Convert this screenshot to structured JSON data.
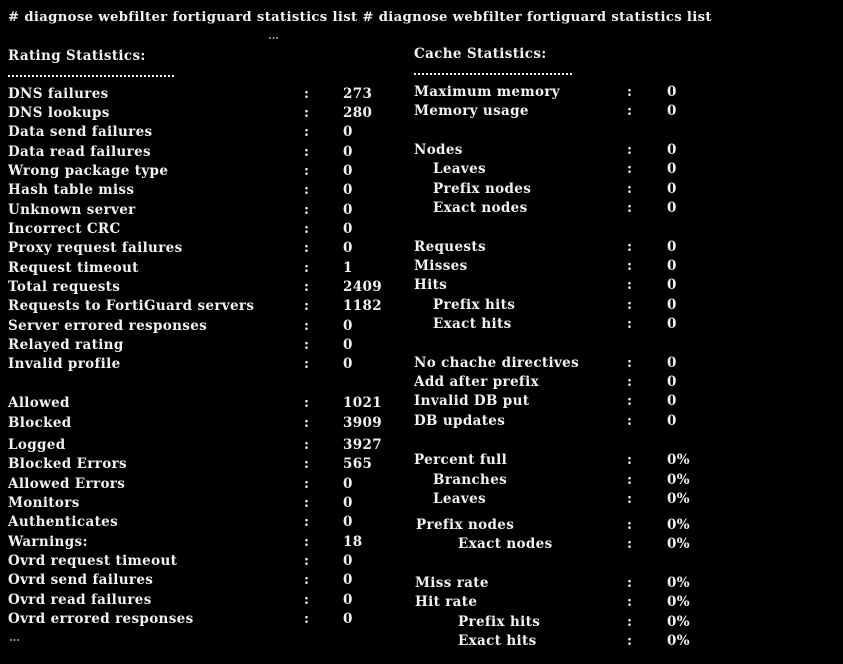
{
  "command": "# diagnose webfilter fortiguard statistics list # diagnose webfilter fortiguard statistics list",
  "ellipsis_top": "…",
  "ellipsis_bottom": "…",
  "separator": ":",
  "rating": {
    "title": "Rating Statistics:",
    "rows": [
      {
        "label": "DNS failures",
        "value": "273"
      },
      {
        "label": "DNS lookups",
        "value": "280"
      },
      {
        "label": "Data send failures",
        "value": "0"
      },
      {
        "label": "Data read failures",
        "value": "0"
      },
      {
        "label": "Wrong package type",
        "value": "0"
      },
      {
        "label": "Hash table miss",
        "value": "0"
      },
      {
        "label": "Unknown server",
        "value": "0"
      },
      {
        "label": "Incorrect CRC",
        "value": "0"
      },
      {
        "label": "Proxy request failures",
        "value": "0"
      },
      {
        "label": "Request timeout",
        "value": "1"
      },
      {
        "label": "Total requests",
        "value": "2409"
      },
      {
        "label": "Requests to FortiGuard servers",
        "value": "1182"
      },
      {
        "label": "Server errored responses",
        "value": "0"
      },
      {
        "label": "Relayed rating",
        "value": "0"
      },
      {
        "label": "Invalid profile",
        "value": "0"
      },
      {
        "label": "Allowed",
        "value": "1021"
      },
      {
        "label": "Blocked",
        "value": "3909"
      },
      {
        "label": "Logged",
        "value": "3927"
      },
      {
        "label": "Blocked Errors",
        "value": "565"
      },
      {
        "label": "Allowed Errors",
        "value": "0"
      },
      {
        "label": "Monitors",
        "value": "0"
      },
      {
        "label": "Authenticates",
        "value": "0"
      },
      {
        "label": "Warnings:",
        "value": "18"
      },
      {
        "label": "Ovrd request timeout",
        "value": "0"
      },
      {
        "label": "Ovrd send failures",
        "value": "0"
      },
      {
        "label": "Ovrd read failures",
        "value": "0"
      },
      {
        "label": "Ovrd errored responses",
        "value": "0"
      }
    ]
  },
  "cache": {
    "title": "Cache Statistics:",
    "rows": [
      {
        "label": "Maximum memory",
        "value": "0"
      },
      {
        "label": "Memory usage",
        "value": "0"
      },
      {
        "label": "Nodes",
        "value": "0"
      },
      {
        "label": "Leaves",
        "value": "0"
      },
      {
        "label": "Prefix nodes",
        "value": "0"
      },
      {
        "label": "Exact nodes",
        "value": "0"
      },
      {
        "label": "Requests",
        "value": "0"
      },
      {
        "label": "Misses",
        "value": "0"
      },
      {
        "label": "Hits",
        "value": "0"
      },
      {
        "label": "Prefix hits",
        "value": "0"
      },
      {
        "label": "Exact hits",
        "value": "0"
      },
      {
        "label": "No chache directives",
        "value": "0"
      },
      {
        "label": "Add after prefix",
        "value": "0"
      },
      {
        "label": "Invalid DB put",
        "value": "0"
      },
      {
        "label": "DB updates",
        "value": "0"
      },
      {
        "label": "Percent full",
        "value": "0%"
      },
      {
        "label": "Branches",
        "value": "0%"
      },
      {
        "label": "Leaves",
        "value": "0%"
      },
      {
        "label": "Prefix nodes",
        "value": "0%"
      },
      {
        "label": "Exact nodes",
        "value": "0%"
      },
      {
        "label": "Miss rate",
        "value": "0%"
      },
      {
        "label": "Hit rate",
        "value": "0%"
      },
      {
        "label": "Prefix hits",
        "value": "0%"
      },
      {
        "label": "Exact hits",
        "value": "0%"
      }
    ]
  }
}
